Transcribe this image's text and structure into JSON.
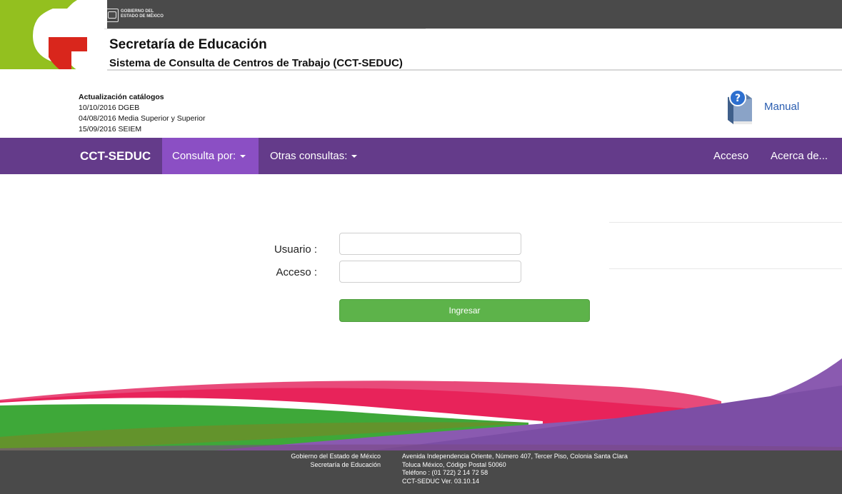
{
  "gov_header": {
    "line1": "GOBIERNO DEL",
    "line2": "ESTADO DE MÉXICO"
  },
  "header": {
    "title": "Secretaría de Educación",
    "subtitle": "Sistema de Consulta de Centros de Trabajo (CCT-SEDUC)"
  },
  "updates": {
    "title": "Actualización catálogos",
    "items": [
      "10/10/2016 DGEB",
      "04/08/2016 Media Superior y Superior",
      "15/09/2016 SEIEM"
    ]
  },
  "manual": {
    "label": "Manual",
    "icon": "help-book-icon"
  },
  "navbar": {
    "brand": "CCT-SEDUC",
    "consulta": "Consulta por:",
    "otras": "Otras consultas:",
    "acceso": "Acceso",
    "acerca": "Acerca de..."
  },
  "login": {
    "usuario_label": "Usuario :",
    "acceso_label": "Acceso :",
    "usuario_value": "",
    "acceso_value": "",
    "submit": "Ingresar"
  },
  "footer": {
    "left": [
      "Gobierno del Estado de México",
      "Secretaría de Educación"
    ],
    "right": [
      "Avenida Independencia Oriente, Número 407, Tercer Piso, Colonia Santa Clara",
      "Toluca México, Código Postal 50060",
      "Teléfono : (01 722) 2 14 72 58",
      "CCT-SEDUC Ver. 03.10.14"
    ]
  },
  "colors": {
    "navbar": "#643b8a",
    "navbar_active": "#8b4fc4",
    "button": "#5db34a",
    "footer": "#4a4a4a",
    "link": "#2a5db0"
  }
}
